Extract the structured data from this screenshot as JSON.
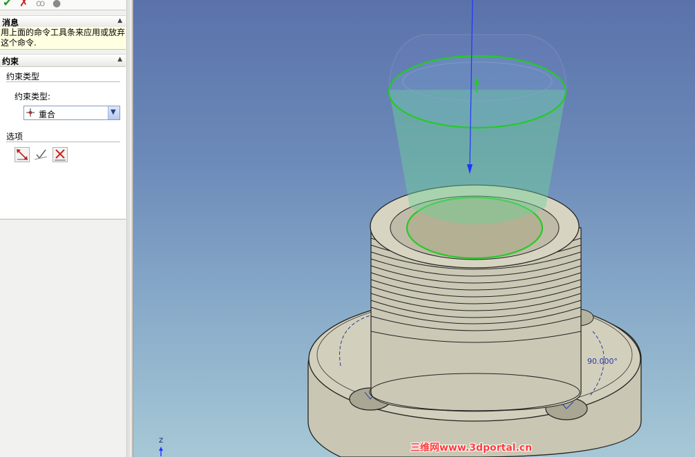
{
  "toolbar": {
    "icons": [
      "checkmark-icon",
      "close-icon",
      "preview-icon",
      "help-icon"
    ]
  },
  "message_section": {
    "title": "消息",
    "text_line1": "用上面的命令工具条来应用或放弃",
    "text_line2": "这个命令."
  },
  "constraint_section": {
    "title": "约束",
    "type_group": "约束类型",
    "type_label": "约束类型:",
    "type_value": "重合",
    "options_group": "选项",
    "option_icons": [
      "flip-direction-icon",
      "accept-icon",
      "remove-constraint-icon"
    ]
  },
  "viewport": {
    "triad_axis": "Z",
    "angle_readout": "90.000°",
    "watermark": "三维网www.3dportal.cn"
  },
  "colors": {
    "accent_green": "#22cc22",
    "axis_blue": "#2233ff",
    "message_bg": "#ffffe1",
    "watermark_red": "#ff3b3b"
  }
}
